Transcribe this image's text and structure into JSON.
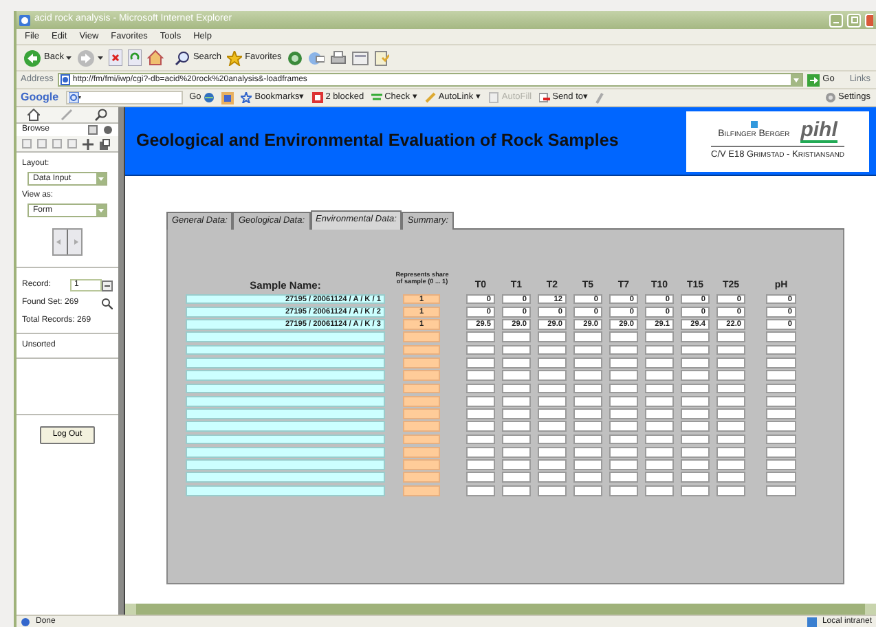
{
  "window": {
    "title": "acid rock analysis - Microsoft Internet Explorer"
  },
  "menu": [
    "File",
    "Edit",
    "View",
    "Favorites",
    "Tools",
    "Help"
  ],
  "toolbar": {
    "back": "Back",
    "search": "Search",
    "favorites": "Favorites"
  },
  "address": {
    "label": "Address",
    "value": "http://fm/fmi/iwp/cgi?-db=acid%20rock%20analysis&-loadframes",
    "go": "Go",
    "links": "Links"
  },
  "google_bar": {
    "logo": "Google",
    "go": "Go",
    "items": [
      {
        "label": "Bookmarks▾",
        "disabled": false
      },
      {
        "label": "2 blocked",
        "disabled": false
      },
      {
        "label": "Check ▾",
        "disabled": false
      },
      {
        "label": "AutoLink ▾",
        "disabled": false
      },
      {
        "label": "AutoFill",
        "disabled": true
      },
      {
        "label": "Send to▾",
        "disabled": false
      }
    ],
    "settings": "Settings"
  },
  "sidebar": {
    "mode": "Browse",
    "layout_label": "Layout:",
    "layout": "Data Input",
    "view_label": "View as:",
    "view": "Form",
    "record_label": "Record:",
    "record": "1",
    "found_set": "Found Set: 269",
    "total": "Total Records: 269",
    "sort": "Unsorted",
    "logout": "Log Out"
  },
  "header": {
    "title": "Geological and Environmental Evaluation of Rock Samples",
    "logo": {
      "company": "Bilfinger Berger",
      "brand": "pihl",
      "project": "C/V E18 Grimstad - Kristiansand"
    }
  },
  "tabs": [
    {
      "label": "General Data:",
      "selected": false
    },
    {
      "label": "Geological Data:",
      "selected": false
    },
    {
      "label": "Environmental Data:",
      "selected": true
    },
    {
      "label": "Summary:",
      "selected": false
    }
  ],
  "table": {
    "columns": [
      "Sample Name:",
      "Represents share of sample (0 ... 1)",
      "T0",
      "T1",
      "T2",
      "T5",
      "T7",
      "T10",
      "T15",
      "T25",
      "pH"
    ],
    "rows": [
      {
        "sample": "27195 / 20061124 / A / K / 1",
        "share": "1",
        "values": [
          "0",
          "0",
          "12",
          "0",
          "0",
          "0",
          "0",
          "0"
        ],
        "ph": "0"
      },
      {
        "sample": "27195 / 20061124 / A / K / 2",
        "share": "1",
        "values": [
          "0",
          "0",
          "0",
          "0",
          "0",
          "0",
          "0",
          "0"
        ],
        "ph": "0"
      },
      {
        "sample": "27195 / 20061124 / A / K / 3",
        "share": "1",
        "values": [
          "29.5",
          "29.0",
          "29.0",
          "29.0",
          "29.0",
          "29.1",
          "29.4",
          "22.0"
        ],
        "ph": "0"
      }
    ]
  },
  "status_bar": {
    "left": "Done",
    "right": "Local intranet"
  }
}
